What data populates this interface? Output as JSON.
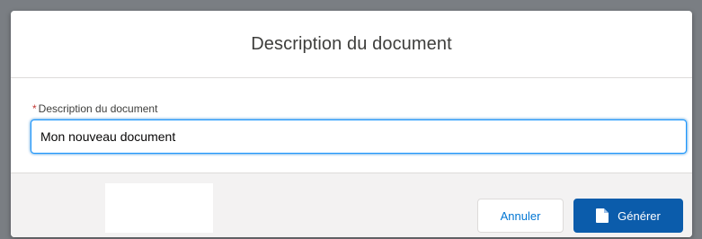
{
  "modal": {
    "title": "Description du document"
  },
  "form": {
    "field_label": "Description du document",
    "required_marker": "*",
    "field_value": "Mon nouveau document"
  },
  "footer": {
    "cancel_label": "Annuler",
    "generate_label": "Générer",
    "generate_icon": "document-icon"
  },
  "colors": {
    "brand": "#0b5cab",
    "focus_border": "#1b96ff",
    "required": "#c23934",
    "link_text": "#0176d3"
  }
}
